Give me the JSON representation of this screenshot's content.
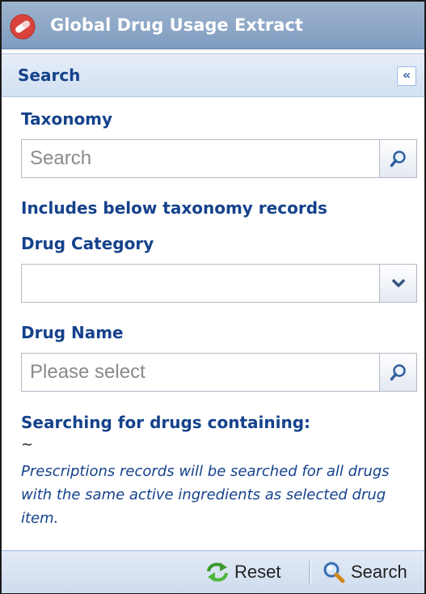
{
  "window": {
    "title": "Global Drug Usage Extract",
    "logo_icon": "red-pill-icon"
  },
  "panel": {
    "title": "Search",
    "collapse_glyph": "«"
  },
  "taxonomy": {
    "label": "Taxonomy",
    "placeholder": "Search",
    "value": "",
    "trigger_icon": "search-magnifier-icon"
  },
  "includes_text": "Includes below taxonomy records",
  "drug_category": {
    "label": "Drug Category",
    "value": "",
    "trigger_icon": "chevron-down-icon"
  },
  "drug_name": {
    "label": "Drug Name",
    "placeholder": "Please select",
    "value": "",
    "trigger_icon": "search-magnifier-icon"
  },
  "searching": {
    "label": "Searching for drugs containing:",
    "prefix": "~",
    "note": "Prescriptions records will be searched for all drugs with the same active ingredients as selected drug item."
  },
  "toolbar": {
    "reset_label": "Reset",
    "reset_icon": "refresh-arrows-icon",
    "search_label": "Search",
    "search_icon": "magnifier-icon"
  },
  "colors": {
    "label_blue": "#15428b",
    "titlebar": "#8ba6c8",
    "panel_header": "#dae6f4",
    "border": "#b5b8c8"
  }
}
